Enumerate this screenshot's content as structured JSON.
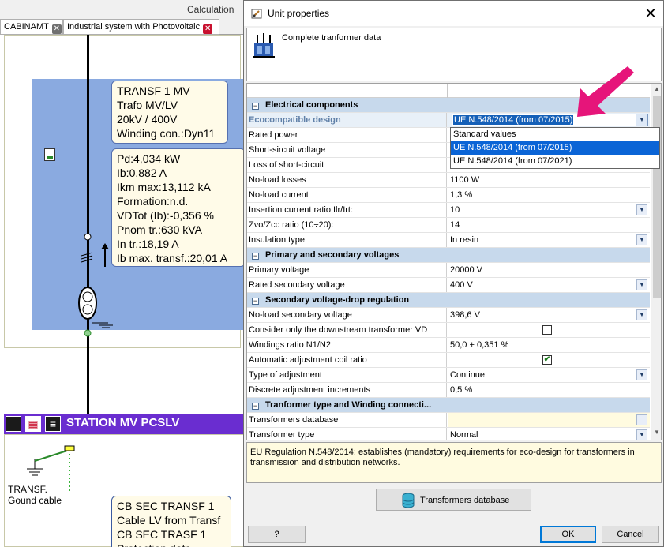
{
  "background": {
    "calculation_label": "Calculation",
    "tabs": [
      {
        "label": "CABINAMT"
      },
      {
        "label": "Industrial system with Photovoltaic"
      }
    ],
    "transf_box": "TRANSF 1 MV\nTrafo MV/LV\n20kV / 400V\nWinding con.:Dyn11",
    "data_box": "Pd:4,034 kW\nIb:0,882 A\nIkm max:13,112 kA\nFormation:n.d.\nVDTot (Ib):-0,356 %\nPnom tr.:630 kVA\nIn tr.:18,19 A\nIb max. transf.:20,01 A",
    "station_title": "STATION MV PCSLV",
    "ground_label": "TRANSF.\nGound cable",
    "cb_box": "CB SEC TRANSF 1\nCable LV from Transf\nCB SEC TRASF 1\nProtection data"
  },
  "dialog": {
    "title": "Unit properties",
    "header_text": "Complete tranformer data",
    "selected_value": "UE N.548/2014 (from 07/2015)",
    "dropdown_options": [
      {
        "label": "Standard values"
      },
      {
        "label": "UE N.548/2014 (from 07/2015)"
      },
      {
        "label": "UE N.548/2014 (from 07/2021)"
      }
    ],
    "rows": [
      {
        "type": "cat",
        "label": "Electrical components",
        "toggle": "−"
      },
      {
        "type": "sel",
        "label": "Ecocompatible design",
        "value": ""
      },
      {
        "label": "Rated power",
        "value": ""
      },
      {
        "label": "Short-sircuit voltage",
        "value": ""
      },
      {
        "label": "Loss of short-circuit",
        "value": ""
      },
      {
        "label": "No-load losses",
        "value": "1100 W"
      },
      {
        "label": "No-load current",
        "value": "1,3 %"
      },
      {
        "label": "Insertion current ratio Ilr/Irt:",
        "value": "10",
        "dropdown": true
      },
      {
        "label": "Zvo/Zcc ratio (10÷20):",
        "value": "14"
      },
      {
        "label": "Insulation type",
        "value": "In resin",
        "dropdown": true
      },
      {
        "type": "cat",
        "label": "Primary and secondary voltages",
        "toggle": "−"
      },
      {
        "label": "Primary voltage",
        "value": "20000 V"
      },
      {
        "label": "Rated secondary voltage",
        "value": "400 V",
        "dropdown": true
      },
      {
        "type": "cat",
        "label": "Secondary voltage-drop regulation",
        "toggle": "−"
      },
      {
        "label": "No-load secondary voltage",
        "value": "398,6 V",
        "dropdown": true
      },
      {
        "label": "Consider only the downstream transformer VD",
        "value": "",
        "checkbox": "unchecked"
      },
      {
        "label": "Windings ratio N1/N2",
        "value": "50,0 + 0,351 %"
      },
      {
        "label": "Automatic adjustment coil ratio",
        "value": "",
        "checkbox": "checked"
      },
      {
        "label": "Type of adjustment",
        "value": "Continue",
        "dropdown": true
      },
      {
        "label": "Discrete adjustment increments",
        "value": "0,5 %"
      },
      {
        "type": "cat",
        "label": "Tranformer type and Winding connecti...",
        "toggle": "−"
      },
      {
        "label": "Transformers database",
        "value": "",
        "dots": true,
        "yellow": true
      },
      {
        "label": "Transformer type",
        "value": "Normal",
        "dropdown": true
      }
    ],
    "description": "EU Regulation N.548/2014: establishes (mandatory) requirements for eco-design for transformers in transmission and distribution networks.",
    "tdb_button": "Transformers database",
    "help_button": "?",
    "ok_button": "OK",
    "cancel_button": "Cancel",
    "accent_color": "#e6157a"
  }
}
